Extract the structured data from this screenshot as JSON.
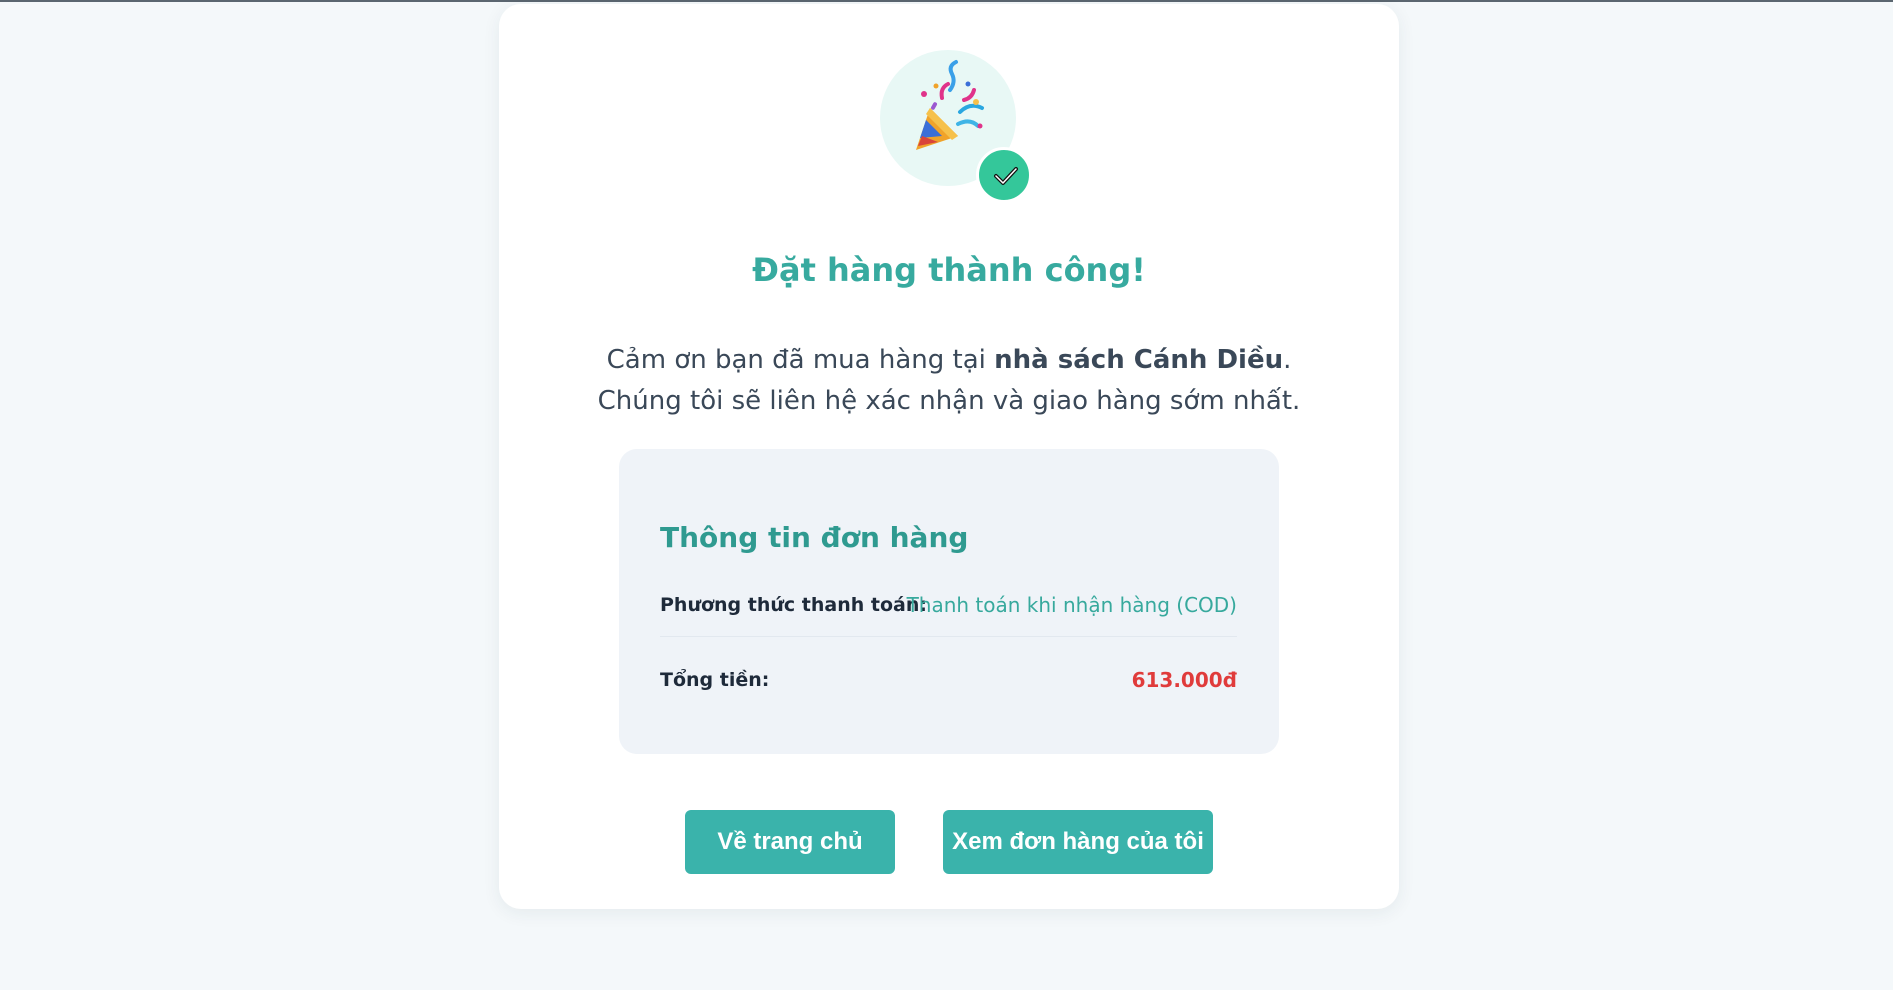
{
  "success": {
    "icon": "party-popper-icon",
    "badge_icon": "check-icon",
    "title": "Đặt hàng thành công!",
    "thanks_prefix": "Cảm ơn bạn đã mua hàng tại ",
    "store_name": "nhà sách Cánh Diều",
    "thanks_suffix": ".",
    "contact_line": "Chúng tôi sẽ liên hệ xác nhận và giao hàng sớm nhất."
  },
  "order_info": {
    "heading": "Thông tin đơn hàng",
    "payment_label": "Phương thức thanh toán:",
    "payment_value": "Thanh toán khi nhận hàng (COD)",
    "total_label": "Tổng tiền:",
    "total_value": "613.000đ"
  },
  "actions": {
    "home_label": "Về trang chủ",
    "orders_label": "Xem đơn hàng của tôi"
  },
  "colors": {
    "accent": "#37aa9f",
    "button": "#3ab3ab",
    "total": "#e03b3b",
    "badge": "#34c79a"
  }
}
